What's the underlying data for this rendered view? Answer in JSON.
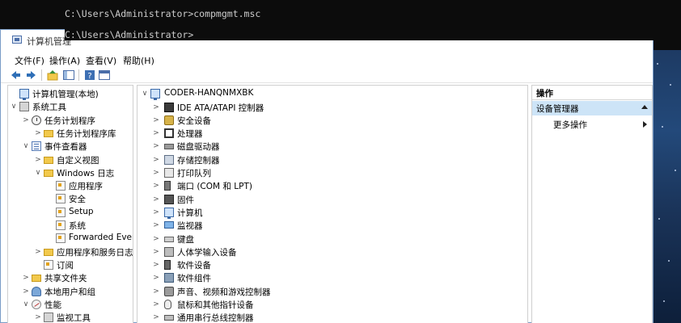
{
  "console": {
    "line1": "C:\\Users\\Administrator>compmgmt.msc",
    "line2": "C:\\Users\\Administrator>"
  },
  "window": {
    "title": "计算机管理"
  },
  "menu": [
    "文件(F)",
    "操作(A)",
    "查看(V)",
    "帮助(H)"
  ],
  "toolbar": {
    "icons": [
      "back-icon",
      "forward-icon",
      "up-icon",
      "show-hide-tree-icon",
      "help-icon",
      "properties-icon"
    ]
  },
  "left_tree": [
    {
      "label": "计算机管理(本地)",
      "indent": 0,
      "twisty": "",
      "icon": "computer-icon"
    },
    {
      "label": "系统工具",
      "indent": 0,
      "twisty": "∨",
      "icon": "tools-icon"
    },
    {
      "label": "任务计划程序",
      "indent": 1,
      "twisty": ">",
      "icon": "clock-icon"
    },
    {
      "label": "任务计划程序库",
      "indent": 2,
      "twisty": ">",
      "icon": "folder-icon"
    },
    {
      "label": "事件查看器",
      "indent": 1,
      "twisty": "∨",
      "icon": "event-viewer-icon"
    },
    {
      "label": "自定义视图",
      "indent": 2,
      "twisty": ">",
      "icon": "folder-icon"
    },
    {
      "label": "Windows 日志",
      "indent": 2,
      "twisty": "∨",
      "icon": "folder-icon"
    },
    {
      "label": "应用程序",
      "indent": 3,
      "twisty": "",
      "icon": "log-icon"
    },
    {
      "label": "安全",
      "indent": 3,
      "twisty": "",
      "icon": "log-icon"
    },
    {
      "label": "Setup",
      "indent": 3,
      "twisty": "",
      "icon": "log-icon"
    },
    {
      "label": "系统",
      "indent": 3,
      "twisty": "",
      "icon": "log-icon"
    },
    {
      "label": "Forwarded Events",
      "indent": 3,
      "twisty": "",
      "icon": "log-icon"
    },
    {
      "label": "应用程序和服务日志",
      "indent": 2,
      "twisty": ">",
      "icon": "folder-icon"
    },
    {
      "label": "订阅",
      "indent": 2,
      "twisty": "",
      "icon": "log-icon"
    },
    {
      "label": "共享文件夹",
      "indent": 1,
      "twisty": ">",
      "icon": "shared-folder-icon"
    },
    {
      "label": "本地用户和组",
      "indent": 1,
      "twisty": ">",
      "icon": "users-icon"
    },
    {
      "label": "性能",
      "indent": 1,
      "twisty": "∨",
      "icon": "performance-icon"
    },
    {
      "label": "监视工具",
      "indent": 2,
      "twisty": ">",
      "icon": "tools-icon"
    }
  ],
  "device_tree": {
    "root": "CODER-HANQNMXBK",
    "items": [
      {
        "label": "IDE ATA/ATAPI 控制器",
        "icon": "ide-controller-icon"
      },
      {
        "label": "安全设备",
        "icon": "security-device-icon"
      },
      {
        "label": "处理器",
        "icon": "processor-icon"
      },
      {
        "label": "磁盘驱动器",
        "icon": "disk-drive-icon"
      },
      {
        "label": "存储控制器",
        "icon": "storage-controller-icon"
      },
      {
        "label": "打印队列",
        "icon": "printer-icon"
      },
      {
        "label": "端口 (COM 和 LPT)",
        "icon": "port-icon"
      },
      {
        "label": "固件",
        "icon": "firmware-icon"
      },
      {
        "label": "计算机",
        "icon": "computer-icon"
      },
      {
        "label": "监视器",
        "icon": "monitor-icon"
      },
      {
        "label": "键盘",
        "icon": "keyboard-icon"
      },
      {
        "label": "人体学输入设备",
        "icon": "hid-icon"
      },
      {
        "label": "软件设备",
        "icon": "software-device-icon"
      },
      {
        "label": "软件组件",
        "icon": "software-component-icon"
      },
      {
        "label": "声音、视频和游戏控制器",
        "icon": "sound-icon"
      },
      {
        "label": "鼠标和其他指针设备",
        "icon": "mouse-icon"
      },
      {
        "label": "通用串行总线控制器",
        "icon": "usb-icon"
      }
    ]
  },
  "actions": {
    "header": "操作",
    "section": "设备管理器",
    "more": "更多操作"
  },
  "colors": {
    "console_bg": "#0c0c0c",
    "console_text": "#cccccc",
    "window_border": "#7a9cc7",
    "action_section_bg": "#cde4f7"
  }
}
